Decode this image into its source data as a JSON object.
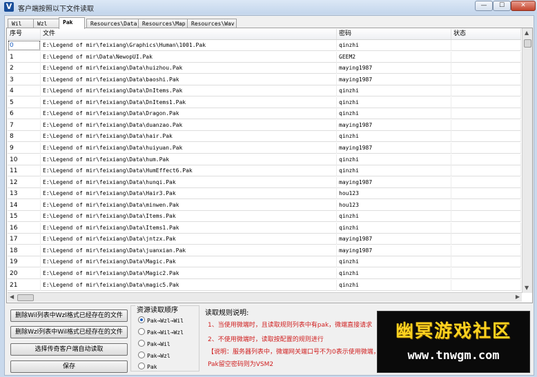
{
  "window": {
    "title": "客户端按照以下文件读取",
    "app_icon_letter": "V",
    "btn_min": "—",
    "btn_max": "☐",
    "btn_close": "✕"
  },
  "tabs": [
    "Wil",
    "Wzl",
    "Pak",
    "Resources\\Data",
    "Resources\\Map",
    "Resources\\Wav"
  ],
  "active_tab": 2,
  "table": {
    "headers": [
      "序号",
      "文件",
      "密码",
      "状态"
    ],
    "rows": [
      [
        "0",
        "E:\\Legend of mir\\feixiang\\Graphics\\Human\\1001.Pak",
        "qinzhi",
        ""
      ],
      [
        "1",
        "E:\\Legend of mir\\Data\\NewopUI.Pak",
        "GEEM2",
        ""
      ],
      [
        "2",
        "E:\\Legend of mir\\feixiang\\Data\\huizhou.Pak",
        "maying1987",
        ""
      ],
      [
        "3",
        "E:\\Legend of mir\\feixiang\\Data\\baoshi.Pak",
        "maying1987",
        ""
      ],
      [
        "4",
        "E:\\Legend of mir\\feixiang\\Data\\DnItems.Pak",
        "qinzhi",
        ""
      ],
      [
        "5",
        "E:\\Legend of mir\\feixiang\\Data\\DnItems1.Pak",
        "qinzhi",
        ""
      ],
      [
        "6",
        "E:\\Legend of mir\\feixiang\\Data\\Dragon.Pak",
        "qinzhi",
        ""
      ],
      [
        "7",
        "E:\\Legend of mir\\feixiang\\Data\\duanzao.Pak",
        "maying1987",
        ""
      ],
      [
        "8",
        "E:\\Legend of mir\\feixiang\\Data\\hair.Pak",
        "qinzhi",
        ""
      ],
      [
        "9",
        "E:\\Legend of mir\\feixiang\\Data\\huiyuan.Pak",
        "maying1987",
        ""
      ],
      [
        "10",
        "E:\\Legend of mir\\feixiang\\Data\\hum.Pak",
        "qinzhi",
        ""
      ],
      [
        "11",
        "E:\\Legend of mir\\feixiang\\Data\\HumEffect6.Pak",
        "qinzhi",
        ""
      ],
      [
        "12",
        "E:\\Legend of mir\\feixiang\\Data\\hunqi.Pak",
        "maying1987",
        ""
      ],
      [
        "13",
        "E:\\Legend of mir\\feixiang\\Data\\Hair3.Pak",
        "hou123",
        ""
      ],
      [
        "14",
        "E:\\Legend of mir\\feixiang\\Data\\minwen.Pak",
        "hou123",
        ""
      ],
      [
        "15",
        "E:\\Legend of mir\\feixiang\\Data\\Items.Pak",
        "qinzhi",
        ""
      ],
      [
        "16",
        "E:\\Legend of mir\\feixiang\\Data\\Items1.Pak",
        "qinzhi",
        ""
      ],
      [
        "17",
        "E:\\Legend of mir\\feixiang\\Data\\jntzx.Pak",
        "maying1987",
        ""
      ],
      [
        "18",
        "E:\\Legend of mir\\feixiang\\Data\\juanxian.Pak",
        "maying1987",
        ""
      ],
      [
        "19",
        "E:\\Legend of mir\\feixiang\\Data\\Magic.Pak",
        "qinzhi",
        ""
      ],
      [
        "20",
        "E:\\Legend of mir\\feixiang\\Data\\Magic2.Pak",
        "qinzhi",
        ""
      ],
      [
        "21",
        "E:\\Legend of mir\\feixiang\\Data\\magic5.Pak",
        "qinzhi",
        ""
      ]
    ]
  },
  "buttons": {
    "delete_wil": "删除Wil列表中Wzl格式已经存在的文件",
    "delete_wzl": "删除Wzl列表中Wil格式已经存在的文件",
    "auto_read": "选择传奇客户端自动读取",
    "save": "保存"
  },
  "resource_order": {
    "title": "资源读取顺序",
    "options": [
      "Pak→Wzl→Wil",
      "Pak→Wil→Wzl",
      "Pak→Wil",
      "Pak→Wzl",
      "Pak"
    ],
    "selected": 0
  },
  "rules": {
    "title": "读取规则说明:",
    "line1": "1、当使用微端时，且读取规则列表中有pak，微端直接请求",
    "line2": "2、不使用微端时，读取按配置的规则进行",
    "line3": "【说明：服务器列表中，微端网关端口号不为0表示使用微端，",
    "line4": "Pak留空密码则为VSM2"
  },
  "watermark": {
    "top": "幽冥游戏社区",
    "bottom": "www.tnwgm.com"
  }
}
